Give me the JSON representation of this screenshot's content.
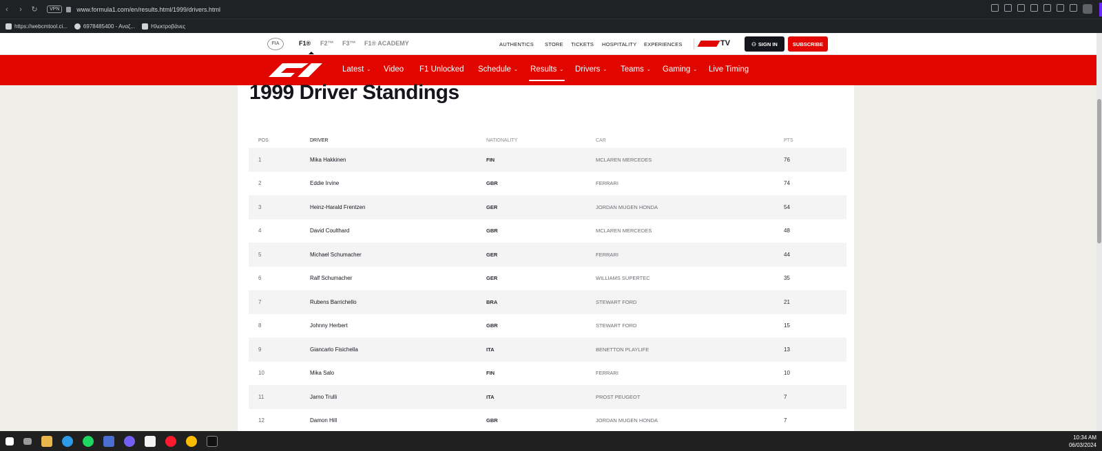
{
  "browser": {
    "url": "www.formula1.com/en/results.html/1999/drivers.html",
    "vpn_label": "VPN",
    "bookmarks": [
      {
        "label": "https://webcmtool.ci..."
      },
      {
        "label": "6978485400 - Αναζ..."
      },
      {
        "label": "Ηλεκτροβάνες"
      }
    ]
  },
  "f1_topbar": {
    "fia_label": "FIA",
    "series": [
      "F1®",
      "F2™",
      "F3™",
      "F1® ACADEMY"
    ],
    "links": [
      "AUTHENTICS",
      "STORE",
      "TICKETS",
      "HOSPITALITY",
      "EXPERIENCES"
    ],
    "tv_label": "TV",
    "signin_label": "SIGN IN",
    "subscribe_label": "SUBSCRIBE"
  },
  "main_nav": {
    "items": [
      {
        "label": "Latest",
        "dropdown": true
      },
      {
        "label": "Video",
        "dropdown": false
      },
      {
        "label": "F1 Unlocked",
        "dropdown": false
      },
      {
        "label": "Schedule",
        "dropdown": true
      },
      {
        "label": "Results",
        "dropdown": true,
        "active": true
      },
      {
        "label": "Drivers",
        "dropdown": true
      },
      {
        "label": "Teams",
        "dropdown": true
      },
      {
        "label": "Gaming",
        "dropdown": true
      },
      {
        "label": "Live Timing",
        "dropdown": false
      }
    ]
  },
  "standings": {
    "title": "1999 Driver Standings",
    "headers": {
      "pos": "POS",
      "driver": "DRIVER",
      "nationality": "NATIONALITY",
      "car": "CAR",
      "pts": "PTS"
    },
    "rows": [
      {
        "pos": "1",
        "driver": "Mika Hakkinen",
        "nationality": "FIN",
        "car": "MCLAREN MERCEDES",
        "pts": "76"
      },
      {
        "pos": "2",
        "driver": "Eddie Irvine",
        "nationality": "GBR",
        "car": "FERRARI",
        "pts": "74"
      },
      {
        "pos": "3",
        "driver": "Heinz-Harald Frentzen",
        "nationality": "GER",
        "car": "JORDAN MUGEN HONDA",
        "pts": "54"
      },
      {
        "pos": "4",
        "driver": "David Coulthard",
        "nationality": "GBR",
        "car": "MCLAREN MERCEDES",
        "pts": "48"
      },
      {
        "pos": "5",
        "driver": "Michael Schumacher",
        "nationality": "GER",
        "car": "FERRARI",
        "pts": "44"
      },
      {
        "pos": "6",
        "driver": "Ralf Schumacher",
        "nationality": "GER",
        "car": "WILLIAMS SUPERTEC",
        "pts": "35"
      },
      {
        "pos": "7",
        "driver": "Rubens Barrichello",
        "nationality": "BRA",
        "car": "STEWART FORD",
        "pts": "21"
      },
      {
        "pos": "8",
        "driver": "Johnny Herbert",
        "nationality": "GBR",
        "car": "STEWART FORD",
        "pts": "15"
      },
      {
        "pos": "9",
        "driver": "Giancarlo Fisichella",
        "nationality": "ITA",
        "car": "BENETTON PLAYLIFE",
        "pts": "13"
      },
      {
        "pos": "10",
        "driver": "Mika Salo",
        "nationality": "FIN",
        "car": "FERRARI",
        "pts": "10"
      },
      {
        "pos": "11",
        "driver": "Jarno Trulli",
        "nationality": "ITA",
        "car": "PROST PEUGEOT",
        "pts": "7"
      },
      {
        "pos": "12",
        "driver": "Damon Hill",
        "nationality": "GBR",
        "car": "JORDAN MUGEN HONDA",
        "pts": "7"
      }
    ]
  },
  "taskbar": {
    "time": "10:34 AM",
    "date": "06/03/2024",
    "icons": [
      "windows-start-icon",
      "task-view-icon",
      "file-explorer-icon",
      "edge-icon",
      "spotify-icon",
      "app-icon",
      "viber-icon",
      "calendar-icon",
      "opera-icon",
      "chrome-icon",
      "audio-app-icon"
    ]
  },
  "colors": {
    "brand_red": "#e10600",
    "dark": "#15151e"
  }
}
